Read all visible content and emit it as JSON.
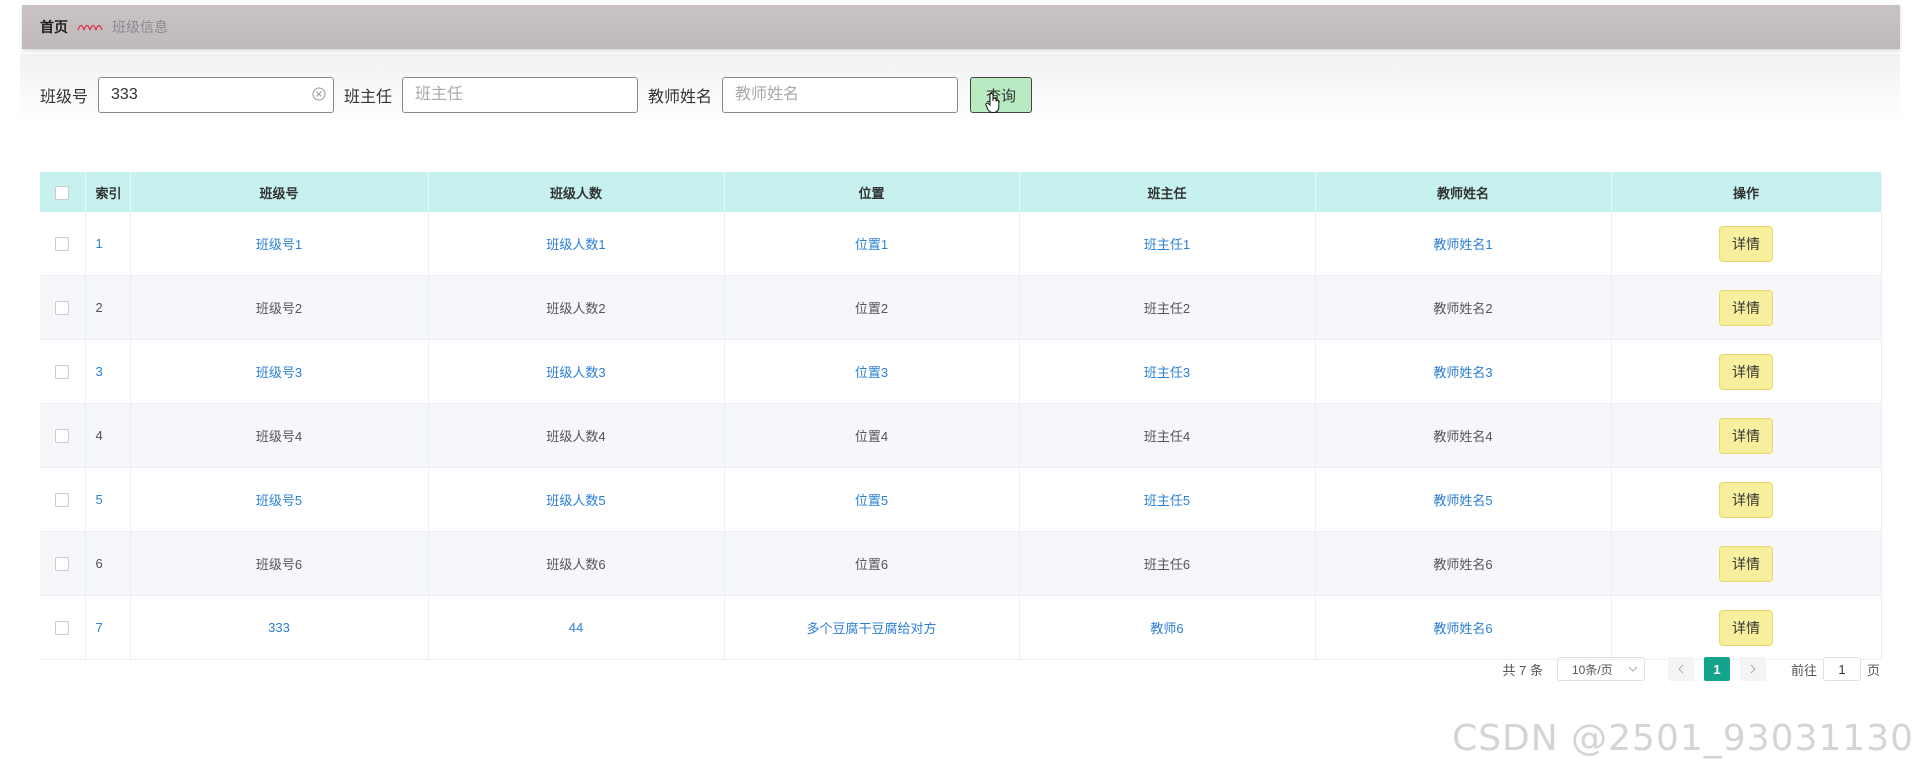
{
  "breadcrumb": {
    "home": "首页",
    "current": "班级信息"
  },
  "search": {
    "fields": [
      {
        "label": "班级号",
        "value": "333",
        "placeholder": ""
      },
      {
        "label": "班主任",
        "value": "",
        "placeholder": "班主任"
      },
      {
        "label": "教师姓名",
        "value": "",
        "placeholder": "教师姓名"
      }
    ],
    "query_label": "查询"
  },
  "table": {
    "columns": [
      "索引",
      "班级号",
      "班级人数",
      "位置",
      "班主任",
      "教师姓名",
      "操作"
    ],
    "rows": [
      {
        "index": "1",
        "class_no": "班级号1",
        "size": "班级人数1",
        "location": "位置1",
        "head_teacher": "班主任1",
        "teacher": "教师姓名1",
        "action": "详情"
      },
      {
        "index": "2",
        "class_no": "班级号2",
        "size": "班级人数2",
        "location": "位置2",
        "head_teacher": "班主任2",
        "teacher": "教师姓名2",
        "action": "详情"
      },
      {
        "index": "3",
        "class_no": "班级号3",
        "size": "班级人数3",
        "location": "位置3",
        "head_teacher": "班主任3",
        "teacher": "教师姓名3",
        "action": "详情"
      },
      {
        "index": "4",
        "class_no": "班级号4",
        "size": "班级人数4",
        "location": "位置4",
        "head_teacher": "班主任4",
        "teacher": "教师姓名4",
        "action": "详情"
      },
      {
        "index": "5",
        "class_no": "班级号5",
        "size": "班级人数5",
        "location": "位置5",
        "head_teacher": "班主任5",
        "teacher": "教师姓名5",
        "action": "详情"
      },
      {
        "index": "6",
        "class_no": "班级号6",
        "size": "班级人数6",
        "location": "位置6",
        "head_teacher": "班主任6",
        "teacher": "教师姓名6",
        "action": "详情"
      },
      {
        "index": "7",
        "class_no": "333",
        "size": "44",
        "location": "多个豆腐干豆腐给对方",
        "head_teacher": "教师6",
        "teacher": "教师姓名6",
        "action": "详情"
      }
    ]
  },
  "pagination": {
    "total": "共 7 条",
    "page_size": "10条/页",
    "current_page": "1",
    "goto_prefix": "前往",
    "goto_value": "1",
    "goto_suffix": "页"
  },
  "watermark": "CSDN @2501_93031130",
  "colors": {
    "header_bg": "#c6f1ee",
    "link_blue": "#2b7fd6",
    "query_button": "#b8ebc2",
    "detail_button": "#f7ef9e",
    "active_page": "#14a38b"
  }
}
